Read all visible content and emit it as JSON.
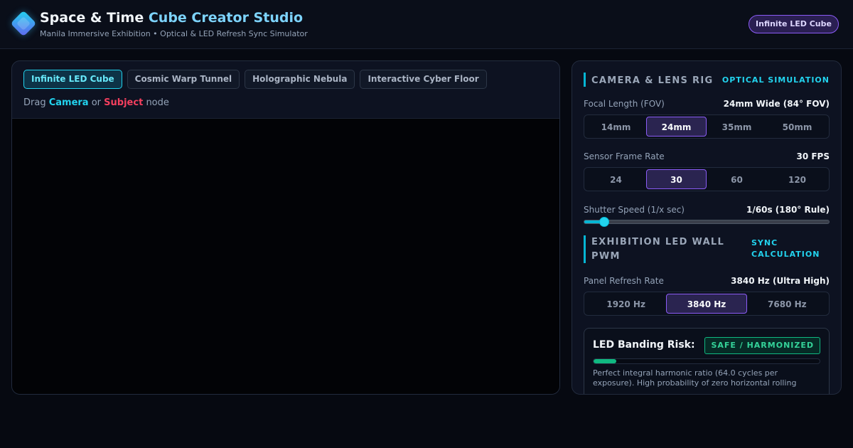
{
  "app": {
    "title_part1": "Space & Time",
    "title_part2": "Cube Creator Studio",
    "subtitle": "Manila Immersive Exhibition • Optical & LED Refresh Sync Simulator",
    "mode_badge": "Infinite LED Cube"
  },
  "scene": {
    "tabs": [
      {
        "label": "Infinite LED Cube",
        "active": true
      },
      {
        "label": "Cosmic Warp Tunnel",
        "active": false
      },
      {
        "label": "Holographic Nebula",
        "active": false
      },
      {
        "label": "Interactive Cyber Floor",
        "active": false
      }
    ],
    "hint": {
      "prefix": "Drag",
      "camera": "Camera",
      "or": "or",
      "subject": "Subject",
      "suffix": "node"
    }
  },
  "rig": {
    "section_title": "CAMERA & LENS RIG",
    "section_tag": "OPTICAL SIMULATION",
    "focal": {
      "label": "Focal Length (FOV)",
      "value": "24mm Wide (84° FOV)",
      "options": [
        "14mm",
        "24mm",
        "35mm",
        "50mm"
      ],
      "selected_index": 1
    },
    "fps": {
      "label": "Sensor Frame Rate",
      "value": "30 FPS",
      "options": [
        "24",
        "30",
        "60",
        "120"
      ],
      "selected_index": 1
    },
    "shutter": {
      "label": "Shutter Speed (1/x sec)",
      "value": "1/60s (180° Rule)",
      "slider_level": 0.08
    }
  },
  "led": {
    "section_title": "EXHIBITION LED WALL PWM",
    "section_tag": "SYNC CALCULATION",
    "refresh": {
      "label": "Panel Refresh Rate",
      "value": "3840 Hz (Ultra High)",
      "options": [
        "1920 Hz",
        "3840 Hz",
        "7680 Hz"
      ],
      "selected_index": 1
    },
    "risk": {
      "title": "LED Banding Risk:",
      "status": "SAFE / HARMONIZED",
      "level": 0.1,
      "description": "Perfect integral harmonic ratio (64.0 cycles per exposure). High probability of zero horizontal rolling"
    }
  },
  "colors": {
    "accent_cyan": "#22d3ee",
    "accent_violet": "#8b5cf6",
    "subject_red": "#f43f5e",
    "safe_green": "#10b981"
  }
}
